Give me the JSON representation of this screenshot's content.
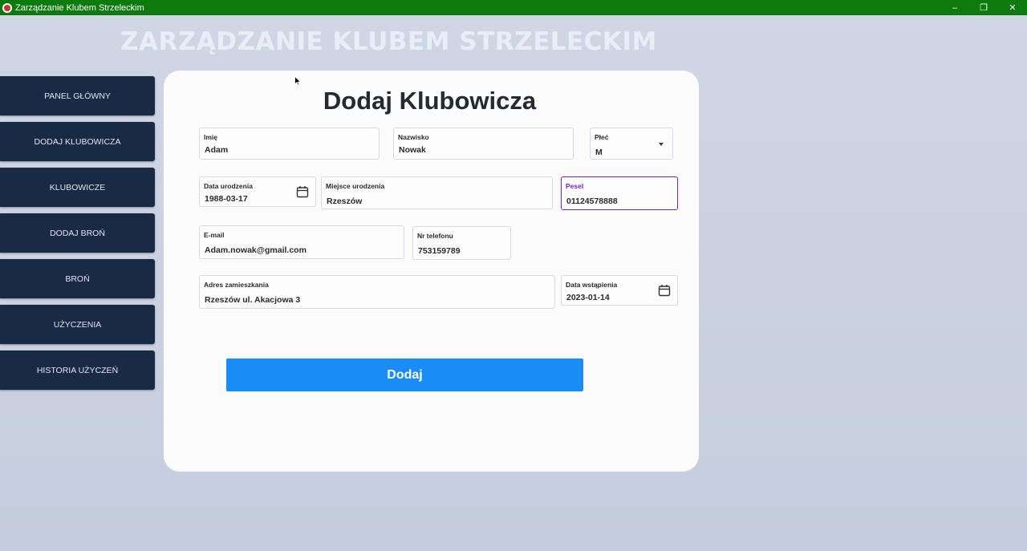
{
  "window": {
    "title": "Zarządzanie Klubem Strzeleckim"
  },
  "app": {
    "heading": "ZARZĄDZANIE KLUBEM STRZELECKIM"
  },
  "sidebar": {
    "items": [
      {
        "label": "PANEL GŁÓWNY"
      },
      {
        "label": "DODAJ KLUBOWICZA"
      },
      {
        "label": "KLUBOWICZE"
      },
      {
        "label": "DODAJ BROŃ"
      },
      {
        "label": "BROŃ"
      },
      {
        "label": "UŻYCZENIA"
      },
      {
        "label": "HISTORIA UŻYCZEŃ"
      }
    ]
  },
  "form": {
    "title": "Dodaj Klubowicza",
    "imie": {
      "label": "Imię",
      "value": "Adam"
    },
    "nazwisko": {
      "label": "Nazwisko",
      "value": "Nowak"
    },
    "plec": {
      "label": "Płeć",
      "value": "M"
    },
    "data_urodzenia": {
      "label": "Data urodzenia",
      "value": "1988-03-17"
    },
    "miejsce_urodzenia": {
      "label": "Miejsce urodzenia",
      "value": "Rzeszów"
    },
    "pesel": {
      "label": "Pesel",
      "value": "01124578888"
    },
    "email": {
      "label": "E-mail",
      "value": "Adam.nowak@gmail.com"
    },
    "telefon": {
      "label": "Nr telefonu",
      "value": "753159789"
    },
    "adres": {
      "label": "Adres zamieszkania",
      "value": "Rzeszów ul. Akacjowa 3"
    },
    "data_wstapienia": {
      "label": "Data wstąpienia",
      "value": "2023-01-14"
    },
    "submit_label": "Dodaj"
  },
  "colors": {
    "titlebar": "#0d7a0d",
    "sidebar_item": "#182a44",
    "submit_button": "#1a8cf6",
    "focus_accent": "#7a1fc7"
  },
  "icons": {
    "date_picker": "calendar-icon",
    "dropdown": "chevron-down-icon"
  }
}
